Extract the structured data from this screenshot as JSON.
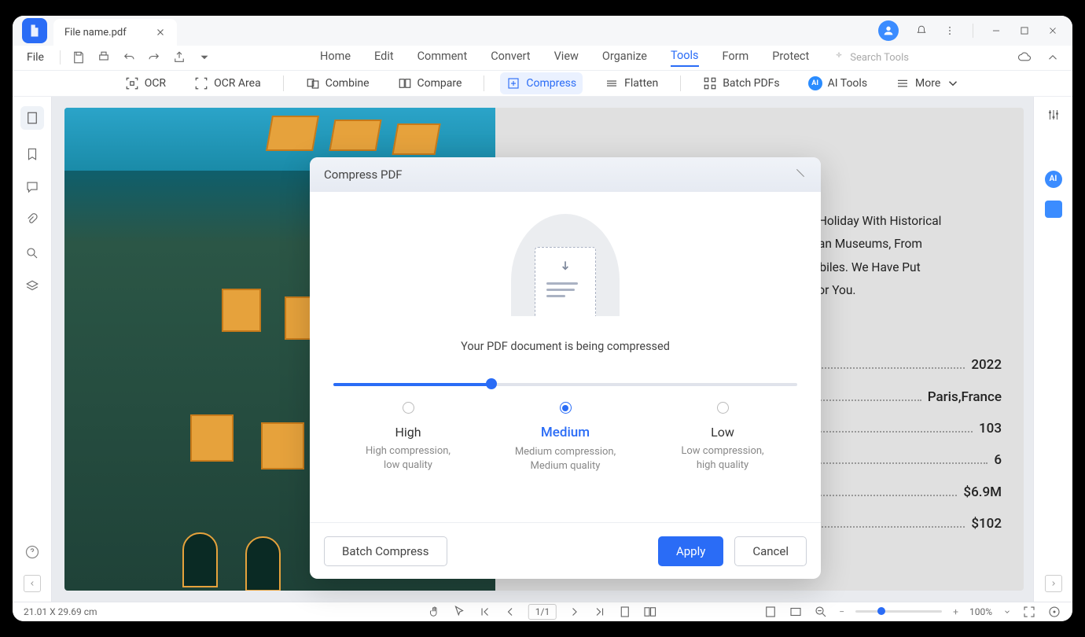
{
  "tab": {
    "filename": "File name.pdf"
  },
  "menubar": {
    "file": "File",
    "items": [
      "Home",
      "Edit",
      "Comment",
      "Convert",
      "View",
      "Organize",
      "Tools",
      "Form",
      "Protect"
    ],
    "active": "Tools",
    "search_placeholder": "Search Tools"
  },
  "toolbar": {
    "ocr": "OCR",
    "ocr_area": "OCR Area",
    "combine": "Combine",
    "compare": "Compare",
    "compress": "Compress",
    "flatten": "Flatten",
    "batch": "Batch PDFs",
    "ai_tools": "AI Tools",
    "more": "More"
  },
  "document": {
    "body_lines": [
      "an Holiday With Historical",
      "ralian Museums, From",
      "mobiles. We Have Put",
      "s For You."
    ],
    "facts": [
      {
        "value": "2022"
      },
      {
        "value": "Paris,France"
      },
      {
        "value": "103"
      },
      {
        "value": "6"
      },
      {
        "value": "$6.9M"
      },
      {
        "value": "$102"
      }
    ]
  },
  "modal": {
    "title": "Compress PDF",
    "status": "Your PDF document is being compressed",
    "options": [
      {
        "key": "high",
        "title": "High",
        "desc1": "High compression,",
        "desc2": "low quality"
      },
      {
        "key": "medium",
        "title": "Medium",
        "desc1": "Medium compression,",
        "desc2": "Medium quality"
      },
      {
        "key": "low",
        "title": "Low",
        "desc1": "Low compression,",
        "desc2": "high quality"
      }
    ],
    "selected": "medium",
    "batch_compress": "Batch Compress",
    "apply": "Apply",
    "cancel": "Cancel"
  },
  "statusbar": {
    "dimensions": "21.01 X 29.69 cm",
    "page": "1/1",
    "zoom": "100%"
  }
}
